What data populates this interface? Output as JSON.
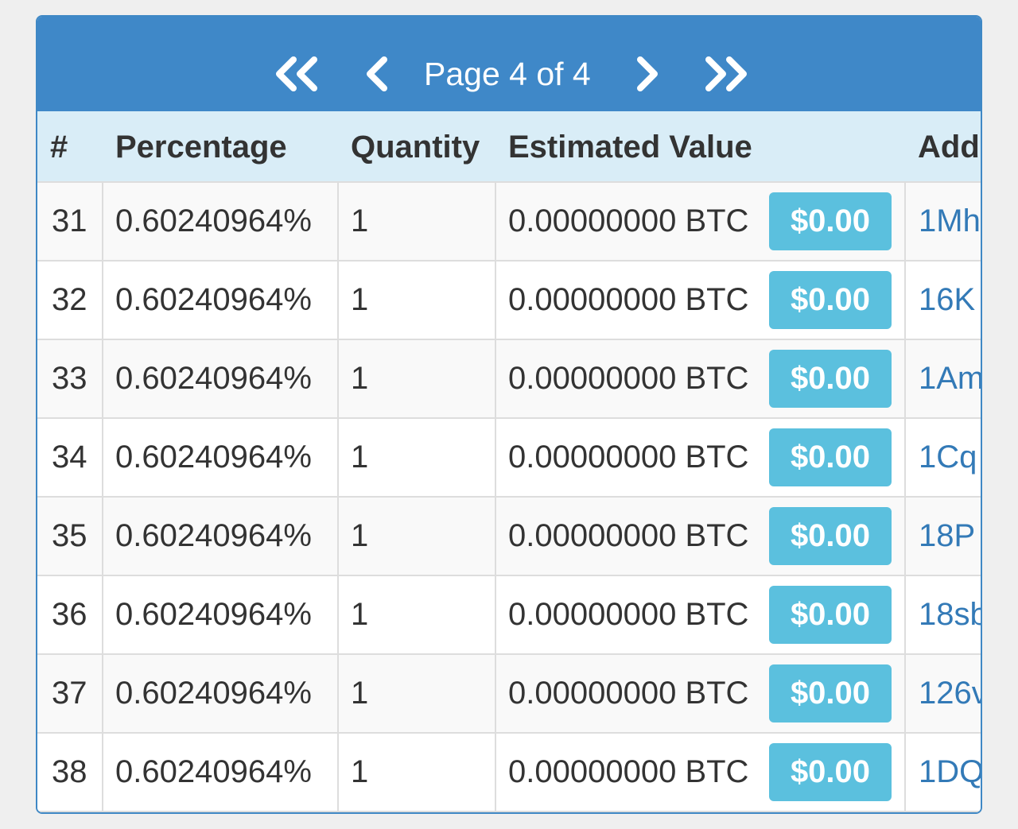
{
  "pagination": {
    "first_icon": "double-chevron-left",
    "prev_icon": "chevron-left",
    "label": "Page 4 of 4",
    "next_icon": "chevron-right",
    "last_icon": "double-chevron-right"
  },
  "table": {
    "columns": [
      "#",
      "Percentage",
      "Quantity",
      "Estimated Value",
      "Add"
    ],
    "rows": [
      {
        "num": "31",
        "percentage": "0.60240964%",
        "quantity": "1",
        "btc": "0.00000000 BTC",
        "usd": "$0.00",
        "address": "1Mh"
      },
      {
        "num": "32",
        "percentage": "0.60240964%",
        "quantity": "1",
        "btc": "0.00000000 BTC",
        "usd": "$0.00",
        "address": "16K"
      },
      {
        "num": "33",
        "percentage": "0.60240964%",
        "quantity": "1",
        "btc": "0.00000000 BTC",
        "usd": "$0.00",
        "address": "1Am"
      },
      {
        "num": "34",
        "percentage": "0.60240964%",
        "quantity": "1",
        "btc": "0.00000000 BTC",
        "usd": "$0.00",
        "address": "1Cq"
      },
      {
        "num": "35",
        "percentage": "0.60240964%",
        "quantity": "1",
        "btc": "0.00000000 BTC",
        "usd": "$0.00",
        "address": "18P"
      },
      {
        "num": "36",
        "percentage": "0.60240964%",
        "quantity": "1",
        "btc": "0.00000000 BTC",
        "usd": "$0.00",
        "address": "18sb"
      },
      {
        "num": "37",
        "percentage": "0.60240964%",
        "quantity": "1",
        "btc": "0.00000000 BTC",
        "usd": "$0.00",
        "address": "126v"
      },
      {
        "num": "38",
        "percentage": "0.60240964%",
        "quantity": "1",
        "btc": "0.00000000 BTC",
        "usd": "$0.00",
        "address": "1DQ"
      }
    ]
  },
  "colors": {
    "header_blue": "#3f88c8",
    "thead_bg": "#d9edf7",
    "usd_badge": "#5bc0de",
    "link": "#337ab7"
  }
}
